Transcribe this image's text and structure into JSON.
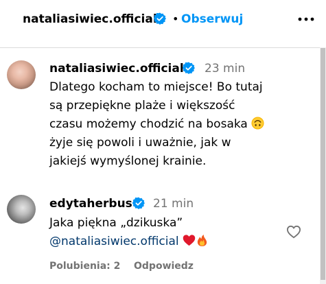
{
  "header": {
    "username": "nataliasiwiec.official",
    "separator": "•",
    "follow_label": "Obserwuj",
    "more_icon": "more-horizontal-icon"
  },
  "comments": [
    {
      "username": "nataliasiwiec.official",
      "verified": true,
      "time": "23 min",
      "text_part1": "Dlatego kocham to miejsce! Bo tutaj są przepiękne plaże i większość czasu możemy chodzić na bosaka ",
      "emoji": "upside-down-face",
      "text_part2": " żyje się powoli i uważnie, jak w jakiejś wymyślonej krainie."
    },
    {
      "username": "edytaherbus",
      "verified": true,
      "time": "21 min",
      "line1": "Jaka piękna „dzikuska”",
      "mention": "@nataliasiwiec.official",
      "emojis": [
        "red-heart",
        "fire"
      ],
      "likes_label": "Polubienia: 2",
      "reply_label": "Odpowiedz"
    }
  ],
  "colors": {
    "follow": "#0095f6",
    "verified": "#0095f6",
    "mention": "#00376b",
    "meta": "#737373"
  }
}
